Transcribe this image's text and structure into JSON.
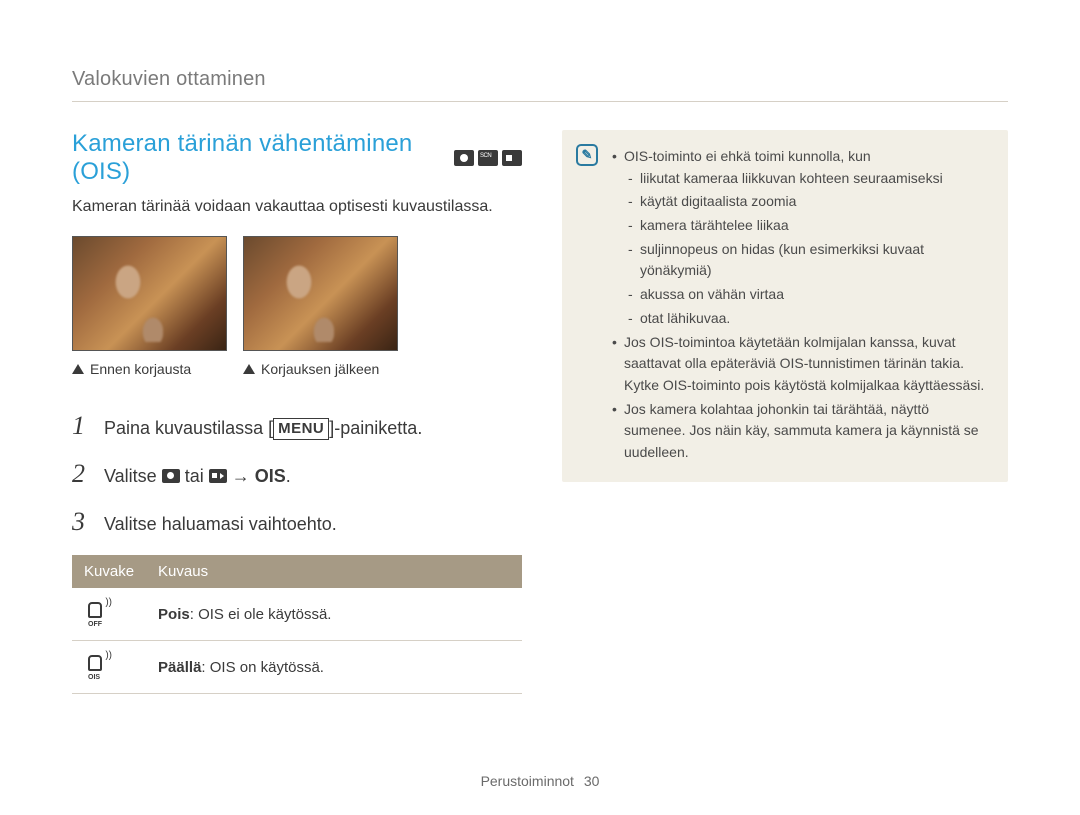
{
  "breadcrumb": "Valokuvien ottaminen",
  "title": "Kameran tärinän vähentäminen (OIS)",
  "mode_icons": [
    "camera-mode-icon",
    "scn-mode-icon",
    "video-mode-icon"
  ],
  "subtitle": "Kameran tärinää voidaan vakauttaa optisesti kuvaustilassa.",
  "photos": {
    "before_caption": "Ennen korjausta",
    "after_caption": "Korjauksen jälkeen"
  },
  "steps": {
    "s1": {
      "num": "1",
      "pre": "Paina kuvaustilassa [",
      "menu": "MENU",
      "post": "]-painiketta."
    },
    "s2": {
      "num": "2",
      "pre": "Valitse ",
      "mid": " tai ",
      "arrow": " → ",
      "ois": "OIS",
      "post": "."
    },
    "s3": {
      "num": "3",
      "text": "Valitse haluamasi vaihtoehto."
    }
  },
  "table": {
    "h1": "Kuvake",
    "h2": "Kuvaus",
    "rows": [
      {
        "icon_sub": "OFF",
        "label": "Pois",
        "desc": ": OIS ei ole käytössä."
      },
      {
        "icon_sub": "OIS",
        "label": "Päällä",
        "desc": ": OIS on käytössä."
      }
    ]
  },
  "note": {
    "intro": "OIS-toiminto ei ehkä toimi kunnolla, kun",
    "sub": [
      "liikutat kameraa liikkuvan kohteen seuraamiseksi",
      "käytät digitaalista zoomia",
      "kamera tärähtelee liikaa",
      "suljinnopeus on hidas (kun esimerkiksi kuvaat yönäkymiä)",
      "akussa on vähän virtaa",
      "otat lähikuvaa."
    ],
    "b2": "Jos OIS-toimintoa käytetään kolmijalan kanssa, kuvat saattavat olla epäteräviä OIS-tunnistimen tärinän takia. Kytke OIS-toiminto pois käytöstä kolmijalkaa käyttäessäsi.",
    "b3": "Jos kamera kolahtaa johonkin tai tärähtää, näyttö sumenee. Jos näin käy, sammuta kamera ja käynnistä se uudelleen."
  },
  "footer": {
    "section": "Perustoiminnot",
    "page": "30"
  }
}
